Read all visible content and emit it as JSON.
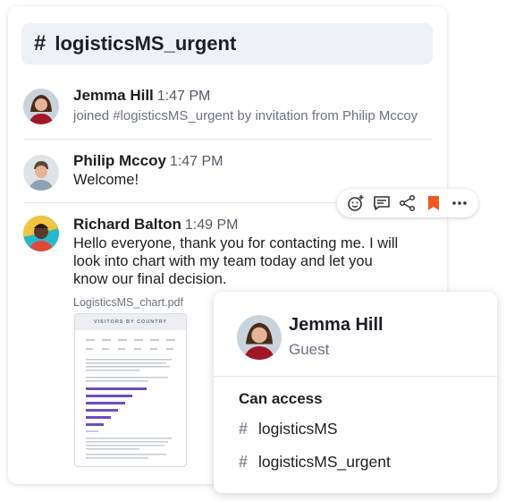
{
  "channel": {
    "hash": "#",
    "name": "logisticsMS_urgent"
  },
  "messages": [
    {
      "author": "Jemma Hill",
      "time": "1:47 PM",
      "meta": "joined #logisticsMS_urgent by invitation from Philip Mccoy",
      "avatar": "jemma-avatar"
    },
    {
      "author": "Philip Mccoy",
      "time": "1:47 PM",
      "text": "Welcome!",
      "avatar": "philip-avatar"
    },
    {
      "author": "Richard Balton",
      "time": "1:49 PM",
      "text_lines": [
        "Hello everyone, thank you for contacting me. I will",
        "look into chart with my team today and let you",
        "know our final decision."
      ],
      "avatar": "richard-avatar"
    }
  ],
  "attachment": {
    "filename": "LogisticsMS_chart.pdf",
    "thumb_title": "VISITORS BY COUNTRY"
  },
  "toolbar": {
    "icons": [
      "add-reaction-icon",
      "reply-icon",
      "share-icon",
      "bookmark-icon",
      "more-icon"
    ],
    "bookmark_color": "#f15a22"
  },
  "profile": {
    "name": "Jemma Hill",
    "role": "Guest",
    "access_label": "Can access",
    "hash": "#",
    "channels": [
      "logisticsMS",
      "logisticsMS_urgent"
    ]
  },
  "colors": {
    "accent_bar": "#6b4fbb"
  }
}
